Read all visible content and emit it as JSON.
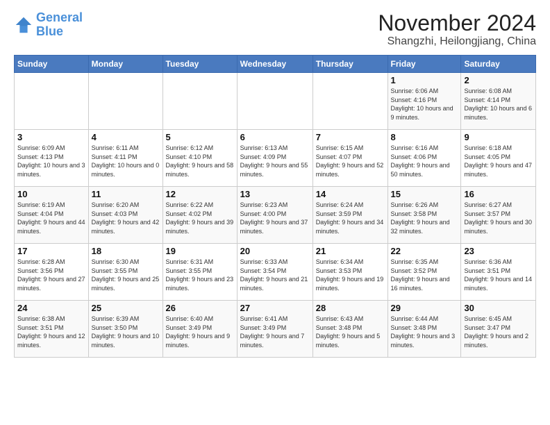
{
  "logo": {
    "line1": "General",
    "line2": "Blue"
  },
  "title": "November 2024",
  "location": "Shangzhi, Heilongjiang, China",
  "days_of_week": [
    "Sunday",
    "Monday",
    "Tuesday",
    "Wednesday",
    "Thursday",
    "Friday",
    "Saturday"
  ],
  "weeks": [
    [
      {
        "day": "",
        "info": ""
      },
      {
        "day": "",
        "info": ""
      },
      {
        "day": "",
        "info": ""
      },
      {
        "day": "",
        "info": ""
      },
      {
        "day": "",
        "info": ""
      },
      {
        "day": "1",
        "info": "Sunrise: 6:06 AM\nSunset: 4:16 PM\nDaylight: 10 hours and 9 minutes."
      },
      {
        "day": "2",
        "info": "Sunrise: 6:08 AM\nSunset: 4:14 PM\nDaylight: 10 hours and 6 minutes."
      }
    ],
    [
      {
        "day": "3",
        "info": "Sunrise: 6:09 AM\nSunset: 4:13 PM\nDaylight: 10 hours and 3 minutes."
      },
      {
        "day": "4",
        "info": "Sunrise: 6:11 AM\nSunset: 4:11 PM\nDaylight: 10 hours and 0 minutes."
      },
      {
        "day": "5",
        "info": "Sunrise: 6:12 AM\nSunset: 4:10 PM\nDaylight: 9 hours and 58 minutes."
      },
      {
        "day": "6",
        "info": "Sunrise: 6:13 AM\nSunset: 4:09 PM\nDaylight: 9 hours and 55 minutes."
      },
      {
        "day": "7",
        "info": "Sunrise: 6:15 AM\nSunset: 4:07 PM\nDaylight: 9 hours and 52 minutes."
      },
      {
        "day": "8",
        "info": "Sunrise: 6:16 AM\nSunset: 4:06 PM\nDaylight: 9 hours and 50 minutes."
      },
      {
        "day": "9",
        "info": "Sunrise: 6:18 AM\nSunset: 4:05 PM\nDaylight: 9 hours and 47 minutes."
      }
    ],
    [
      {
        "day": "10",
        "info": "Sunrise: 6:19 AM\nSunset: 4:04 PM\nDaylight: 9 hours and 44 minutes."
      },
      {
        "day": "11",
        "info": "Sunrise: 6:20 AM\nSunset: 4:03 PM\nDaylight: 9 hours and 42 minutes."
      },
      {
        "day": "12",
        "info": "Sunrise: 6:22 AM\nSunset: 4:02 PM\nDaylight: 9 hours and 39 minutes."
      },
      {
        "day": "13",
        "info": "Sunrise: 6:23 AM\nSunset: 4:00 PM\nDaylight: 9 hours and 37 minutes."
      },
      {
        "day": "14",
        "info": "Sunrise: 6:24 AM\nSunset: 3:59 PM\nDaylight: 9 hours and 34 minutes."
      },
      {
        "day": "15",
        "info": "Sunrise: 6:26 AM\nSunset: 3:58 PM\nDaylight: 9 hours and 32 minutes."
      },
      {
        "day": "16",
        "info": "Sunrise: 6:27 AM\nSunset: 3:57 PM\nDaylight: 9 hours and 30 minutes."
      }
    ],
    [
      {
        "day": "17",
        "info": "Sunrise: 6:28 AM\nSunset: 3:56 PM\nDaylight: 9 hours and 27 minutes."
      },
      {
        "day": "18",
        "info": "Sunrise: 6:30 AM\nSunset: 3:55 PM\nDaylight: 9 hours and 25 minutes."
      },
      {
        "day": "19",
        "info": "Sunrise: 6:31 AM\nSunset: 3:55 PM\nDaylight: 9 hours and 23 minutes."
      },
      {
        "day": "20",
        "info": "Sunrise: 6:33 AM\nSunset: 3:54 PM\nDaylight: 9 hours and 21 minutes."
      },
      {
        "day": "21",
        "info": "Sunrise: 6:34 AM\nSunset: 3:53 PM\nDaylight: 9 hours and 19 minutes."
      },
      {
        "day": "22",
        "info": "Sunrise: 6:35 AM\nSunset: 3:52 PM\nDaylight: 9 hours and 16 minutes."
      },
      {
        "day": "23",
        "info": "Sunrise: 6:36 AM\nSunset: 3:51 PM\nDaylight: 9 hours and 14 minutes."
      }
    ],
    [
      {
        "day": "24",
        "info": "Sunrise: 6:38 AM\nSunset: 3:51 PM\nDaylight: 9 hours and 12 minutes."
      },
      {
        "day": "25",
        "info": "Sunrise: 6:39 AM\nSunset: 3:50 PM\nDaylight: 9 hours and 10 minutes."
      },
      {
        "day": "26",
        "info": "Sunrise: 6:40 AM\nSunset: 3:49 PM\nDaylight: 9 hours and 9 minutes."
      },
      {
        "day": "27",
        "info": "Sunrise: 6:41 AM\nSunset: 3:49 PM\nDaylight: 9 hours and 7 minutes."
      },
      {
        "day": "28",
        "info": "Sunrise: 6:43 AM\nSunset: 3:48 PM\nDaylight: 9 hours and 5 minutes."
      },
      {
        "day": "29",
        "info": "Sunrise: 6:44 AM\nSunset: 3:48 PM\nDaylight: 9 hours and 3 minutes."
      },
      {
        "day": "30",
        "info": "Sunrise: 6:45 AM\nSunset: 3:47 PM\nDaylight: 9 hours and 2 minutes."
      }
    ]
  ]
}
